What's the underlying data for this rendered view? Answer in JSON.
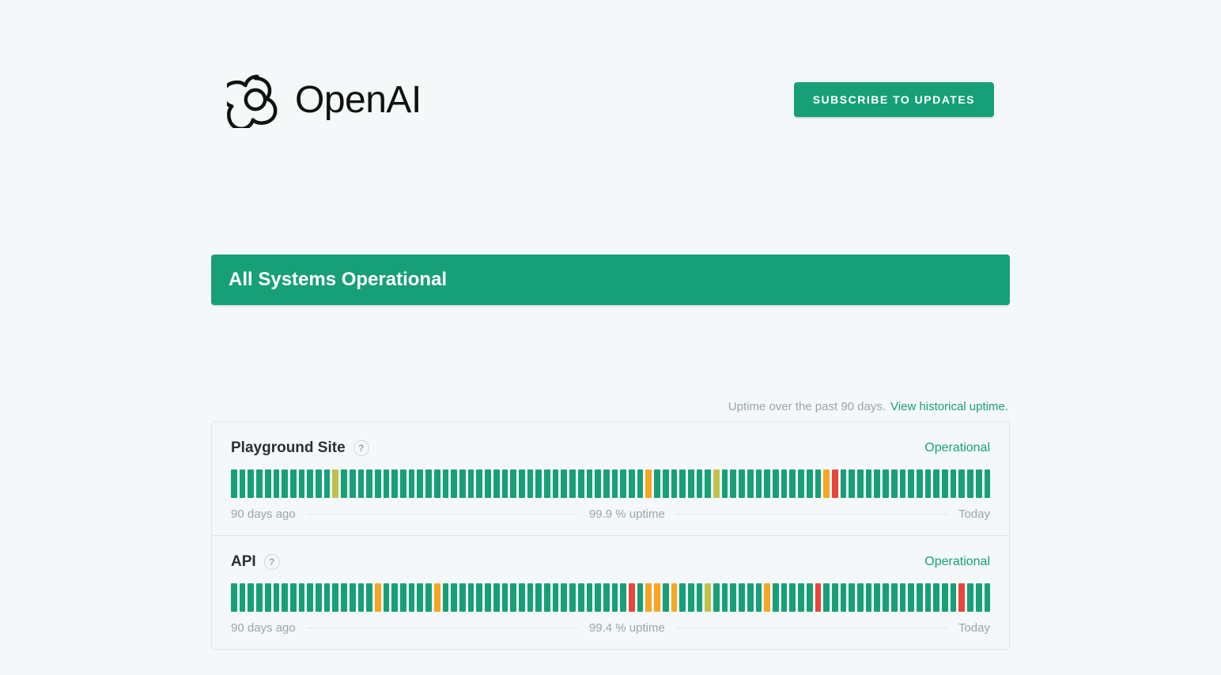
{
  "brand": {
    "name": "OpenAI"
  },
  "header": {
    "subscribe_label": "SUBSCRIBE TO UPDATES"
  },
  "status_banner": {
    "text": "All Systems Operational"
  },
  "uptime_header": {
    "text": "Uptime over the past 90 days.",
    "link": "View historical uptime."
  },
  "components": [
    {
      "name": "Playground Site",
      "status": "Operational",
      "uptime_label": "99.9 % uptime",
      "range_start": "90 days ago",
      "range_end": "Today",
      "bars": "ggggggggggggyggggggggggggggggggggggggggggggggggggogggggggyggggggggggggorgggggggggggggggggg"
    },
    {
      "name": "API",
      "status": "Operational",
      "uptime_label": "99.4 % uptime",
      "range_start": "90 days ago",
      "range_end": "Today",
      "bars": "gggggggggggggggggoggggggoggggggggggggggggggggggrgoogogggyggggggogggggrggggggggggggggggrggg"
    }
  ]
}
